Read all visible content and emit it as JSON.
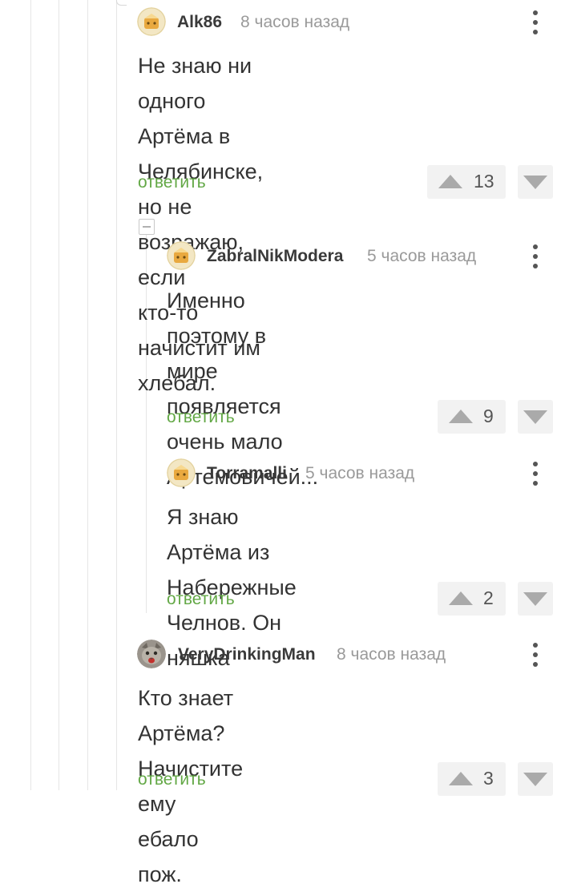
{
  "colors": {
    "reply": "#63a846",
    "muted": "#9a9a9a",
    "text": "#333333"
  },
  "comments": [
    {
      "author": "Alk86",
      "time": "8 часов назад",
      "lines": [
        "Не знаю ни одного Артёма в",
        "Челябинске, но не возражаю, если",
        "кто-то начистит им хлебал."
      ],
      "reply_label": "ответить",
      "rating": "13",
      "avatar_icon": "default-avatar-icon"
    },
    {
      "author": "ZabralNikModera",
      "time": "5 часов назад",
      "lines": [
        "Именно поэтому в мире",
        "появляется очень мало",
        "Артемовичей..."
      ],
      "reply_label": "ответить",
      "rating": "9",
      "avatar_icon": "default-avatar-icon"
    },
    {
      "author": "Torramalli",
      "time": "5 часов назад",
      "lines": [
        "Я знаю Артёма из Набережные",
        "Челнов. Он няшка"
      ],
      "reply_label": "ответить",
      "rating": "2",
      "avatar_icon": "default-avatar-icon"
    },
    {
      "author": "VeryDrinkingMan",
      "time": "8 часов назад",
      "lines": [
        "Кто знает Артёма? Начистите ему",
        "ебало пож."
      ],
      "reply_label": "ответить",
      "rating": "3",
      "avatar_icon": "cat-avatar-icon"
    }
  ]
}
